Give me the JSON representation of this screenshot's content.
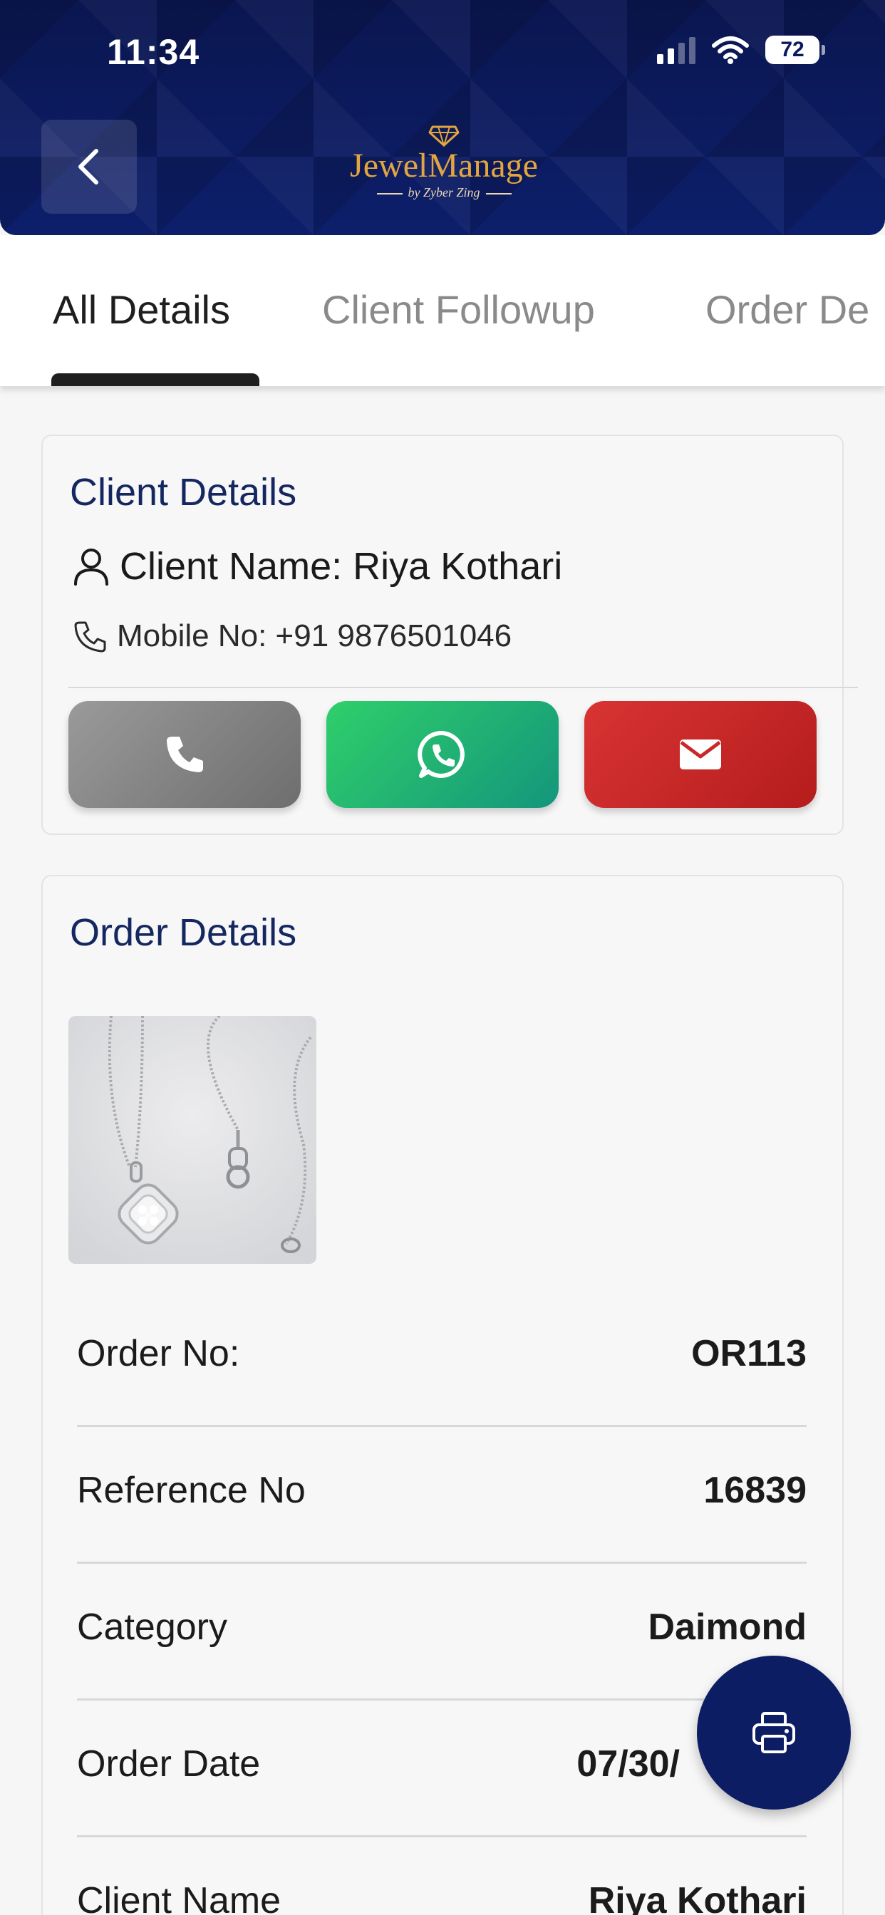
{
  "status_bar": {
    "time": "11:34",
    "battery": "72"
  },
  "header": {
    "logo_name": "JewelManage",
    "logo_sub": "by Zyber Zing"
  },
  "tabs": [
    {
      "label": "All Details",
      "active": true
    },
    {
      "label": "Client Followup",
      "active": false
    },
    {
      "label": "Order De",
      "active": false
    }
  ],
  "client_details": {
    "title": "Client Details",
    "name_text": "Client Name: Riya Kothari",
    "mobile_text": "Mobile No: +91 9876501046"
  },
  "order_details": {
    "title": "Order Details",
    "rows": [
      {
        "label": "Order No:",
        "value": "OR113"
      },
      {
        "label": "Reference No",
        "value": "16839"
      },
      {
        "label": "Category",
        "value": "Daimond"
      },
      {
        "label": "Order Date",
        "value": "07/30/"
      },
      {
        "label": "Client Name",
        "value": "Riya Kothari"
      }
    ]
  },
  "icons": {
    "back": "chevron-left-icon",
    "call": "phone-icon",
    "whatsapp": "whatsapp-icon",
    "mail": "mail-icon",
    "fab": "printer-icon"
  },
  "colors": {
    "header_bg": "#0b1a5e",
    "logo_gold": "#e2a53f",
    "title_navy": "#142760",
    "call_gray": "#8a8a8a",
    "whatsapp_green": "#22b86c",
    "mail_red": "#c92828",
    "fab_navy": "#0c1d64"
  }
}
